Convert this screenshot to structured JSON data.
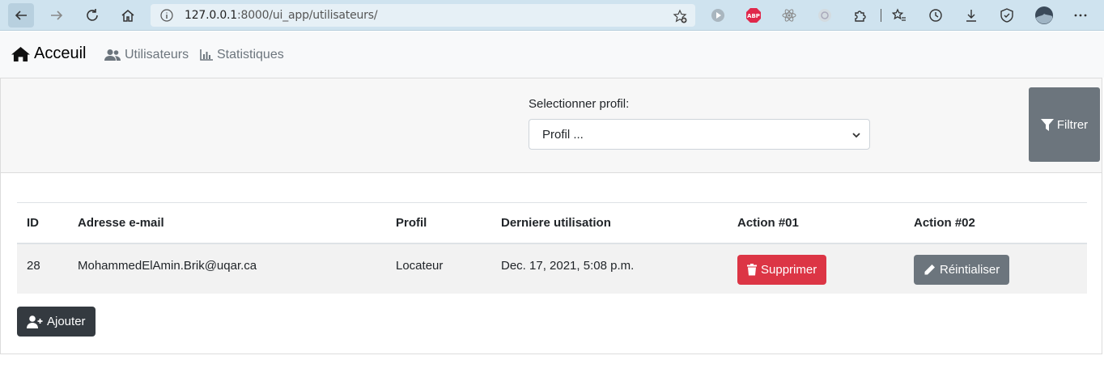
{
  "browser": {
    "url_host": "127.0.0.1",
    "url_rest": ":8000/ui_app/utilisateurs/",
    "extensions": [
      "play-icon",
      "adblock-icon",
      "react-icon",
      "circle-ext-icon",
      "puzzle-icon",
      "favorites-icon",
      "history-icon",
      "download-icon",
      "shield-icon",
      "profile-avatar",
      "more-icon"
    ]
  },
  "navbar": {
    "brand": "Acceuil",
    "links": [
      "Utilisateurs",
      "Statistiques"
    ]
  },
  "filter": {
    "label": "Selectionner profil:",
    "select_value": "Profil ...",
    "button": "Filtrer"
  },
  "table": {
    "headers": [
      "ID",
      "Adresse e-mail",
      "Profil",
      "Derniere utilisation",
      "Action #01",
      "Action #02"
    ],
    "rows": [
      {
        "id": "28",
        "email": "MohammedElAmin.Brik@uqar.ca",
        "profil": "Locateur",
        "last_used": "Dec. 17, 2021, 5:08 p.m.",
        "action1": "Supprimer",
        "action2": "Réintialiser"
      }
    ]
  },
  "add_button": "Ajouter",
  "colors": {
    "danger": "#dc3545",
    "secondary": "#6c757d",
    "dark": "#343a40",
    "chrome": "#cfe3ef"
  }
}
